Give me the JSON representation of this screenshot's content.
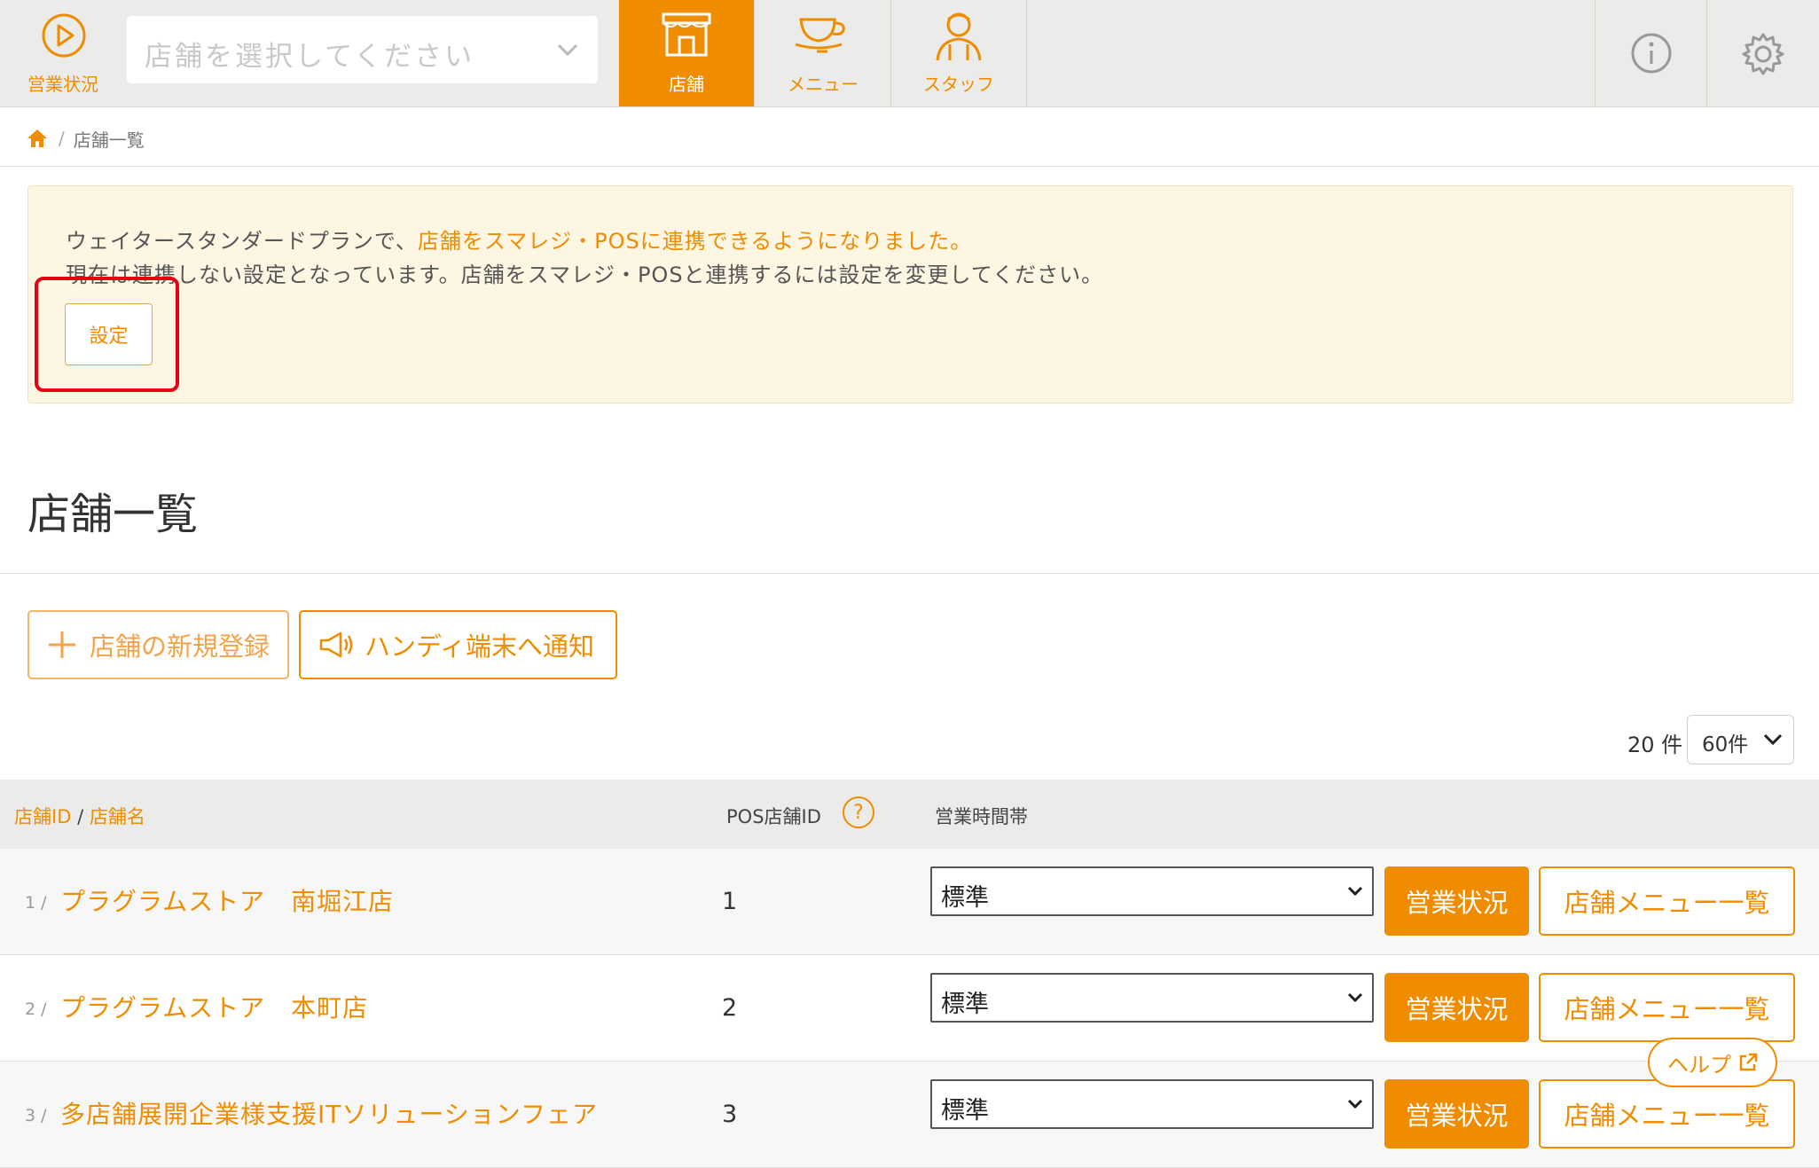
{
  "nav": {
    "status_label": "営業状況",
    "store_select_placeholder": "店舗を選択してください",
    "tabs": [
      {
        "label": "店舗",
        "icon": "storefront-icon",
        "active": true
      },
      {
        "label": "メニュー",
        "icon": "teacup-icon",
        "active": false
      },
      {
        "label": "スタッフ",
        "icon": "staff-icon",
        "active": false
      }
    ],
    "utility_icons": [
      "info-icon",
      "gear-icon"
    ],
    "accent_color": "#f08c00"
  },
  "breadcrumb": {
    "home_icon": "home-icon",
    "current": "店舗一覧"
  },
  "notice": {
    "line1_prefix": "ウェイタースタンダードプランで、",
    "line1_highlight": "店舗をスマレジ・POSに連携できるようになりました。",
    "line2": "現在は連携しない設定となっています。店舗をスマレジ・POSと連携するには設定を変更してください。",
    "setting_button": "設定"
  },
  "page_title": "店舗一覧",
  "actions": {
    "new_store": "店舗の新規登録",
    "notify_handy": "ハンディ端末へ通知"
  },
  "pagination": {
    "count": "20 件",
    "per_page": "60件"
  },
  "table": {
    "headers": {
      "store_id": "店舗ID",
      "slash": "/",
      "store_name": "店舗名",
      "pos_store_id": "POS店舗ID",
      "help": "?",
      "business_hours": "営業時間帯"
    },
    "rows": [
      {
        "index": "1 /",
        "name": "プラグラムストア　南堀江店",
        "pos_id": "1",
        "hours": "標準",
        "status_btn": "営業状況",
        "menu_btn": "店舗メニュー一覧"
      },
      {
        "index": "2 /",
        "name": "プラグラムストア　本町店",
        "pos_id": "2",
        "hours": "標準",
        "status_btn": "営業状況",
        "menu_btn": "店舗メニュー一覧"
      },
      {
        "index": "3 /",
        "name": "多店舗展開企業様支援ITソリューションフェア",
        "pos_id": "3",
        "hours": "標準",
        "status_btn": "営業状況",
        "menu_btn": "店舗メニュー一覧"
      }
    ]
  },
  "help_button": "ヘルプ"
}
